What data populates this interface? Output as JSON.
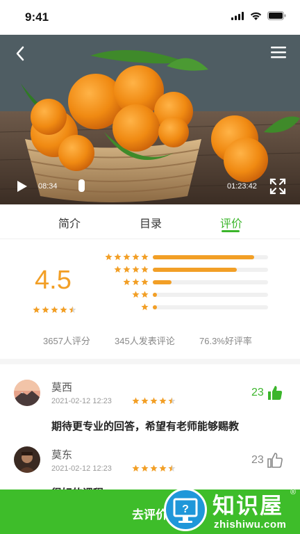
{
  "status_bar": {
    "time": "9:41"
  },
  "video": {
    "current_time": "08:34",
    "total_time": "01:23:42",
    "progress": 0.15
  },
  "tabs": [
    {
      "label": "简介",
      "active": false
    },
    {
      "label": "目录",
      "active": false
    },
    {
      "label": "评价",
      "active": true
    }
  ],
  "rating": {
    "score": "4.5",
    "score_stars": 4.5,
    "distribution": [
      {
        "stars": 5,
        "fraction": 0.88
      },
      {
        "stars": 4,
        "fraction": 0.73
      },
      {
        "stars": 3,
        "fraction": 0.16
      },
      {
        "stars": 2,
        "fraction": 0.03
      },
      {
        "stars": 1,
        "fraction": 0.03
      }
    ],
    "stats": {
      "raters": "3657人评分",
      "commenters": "345人发表评论",
      "positive_rate": "76.3%好评率"
    }
  },
  "reviews": [
    {
      "name": "莫西",
      "date": "2021-02-12 12:23",
      "stars": 4.5,
      "likes": "23",
      "liked": true,
      "text": "期待更专业的回答，希望有老师能够赐教"
    },
    {
      "name": "莫东",
      "date": "2021-02-12 12:23",
      "stars": 4.5,
      "likes": "23",
      "liked": false,
      "text": "很好的课程"
    }
  ],
  "bottom_button": {
    "label": "去评价"
  },
  "watermark": {
    "title": "知识屋",
    "url": "zhishiwu.com",
    "reg": "®"
  },
  "colors": {
    "accent_green": "#3bb52b",
    "bar_green": "#3ebd2a",
    "star_orange": "#f29f26"
  }
}
